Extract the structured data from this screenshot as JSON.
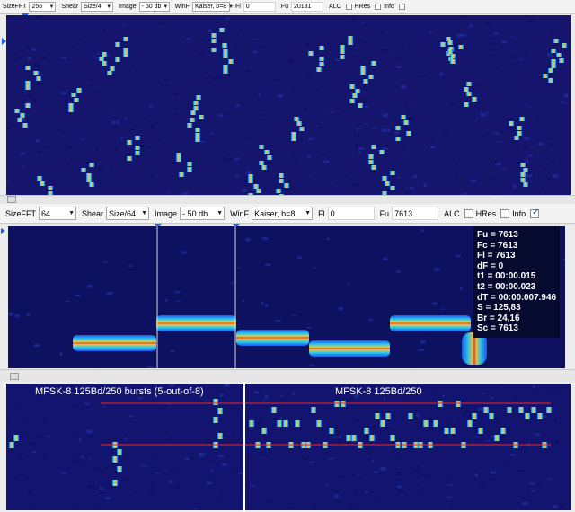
{
  "toolbar_top": {
    "sizefft_label": "SizeFFT",
    "sizefft_value": "256",
    "shear_label": "Shear",
    "shear_value": "Size/4",
    "image_label": "Image",
    "image_value": "- 50 db",
    "winf_label": "WinF",
    "winf_value": "Kaiser, b=8",
    "fl_label": "Fl",
    "fl_value": "0",
    "fu_label": "Fu",
    "fu_value": "20131",
    "alc_label": "ALC",
    "hres_label": "HRes",
    "info_label": "Info",
    "alc_checked": false,
    "hres_checked": false,
    "info_checked": false
  },
  "toolbar_mid": {
    "sizefft_label": "SizeFFT",
    "sizefft_value": "64",
    "shear_label": "Shear",
    "shear_value": "Size/64",
    "image_label": "Image",
    "image_value": "- 50 db",
    "winf_label": "WinF",
    "winf_value": "Kaiser, b=8",
    "fl_label": "Fl",
    "fl_value": "0",
    "fu_label": "Fu",
    "fu_value": "7613",
    "alc_label": "ALC",
    "hres_label": "HRes",
    "info_label": "Info",
    "alc_checked": false,
    "hres_checked": false,
    "info_checked": true
  },
  "readout": {
    "fu": "Fu = 7613",
    "fc": "Fc = 7613",
    "fl": "Fl = 7613",
    "df": "dF = 0",
    "t1": "t1 = 00:00.015",
    "t2": "t2 = 00:00.023",
    "dt": "dT = 00:00.007.946",
    "s": "S = 125,83",
    "br": "Br = 24,16",
    "sc": "Sc = 7613"
  },
  "captions": {
    "left": "MFSK-8 125Bd/250  bursts (5-out-of-8)",
    "right": "MFSK-8 125Bd/250"
  },
  "colors": {
    "background": "#131470",
    "signal_core": "#ff6020",
    "signal_edge": "#30c8ff",
    "reference_line": "#ff2020"
  }
}
